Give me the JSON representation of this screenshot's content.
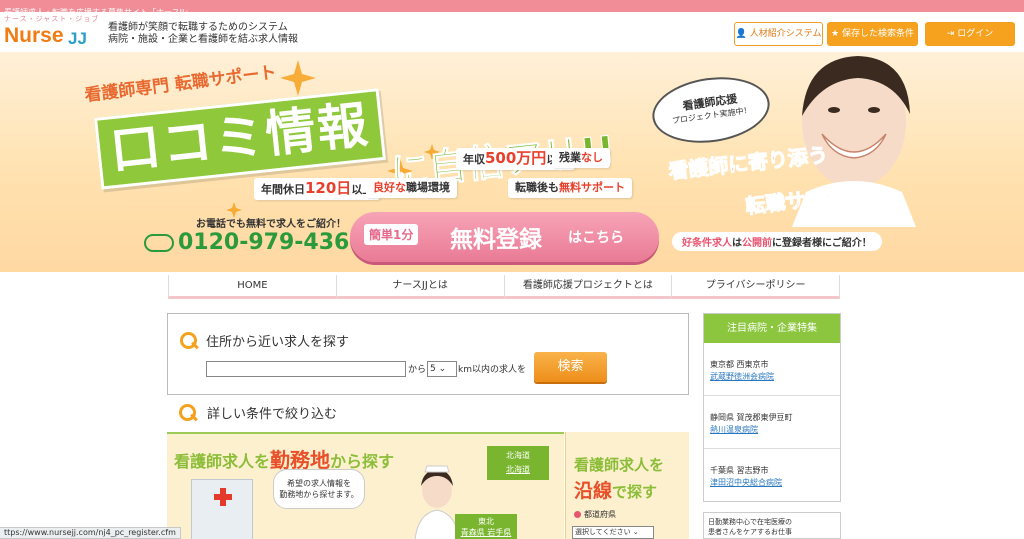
{
  "top_strip": "看護師求人・転職を応援する募集サイト「ナースJJ」",
  "logo": {
    "kana": "ナース・ジャスト・ジョブ",
    "nurse": "Nurse",
    "jj": "JJ"
  },
  "tagline": [
    "看護師が笑顔で転職するためのシステム",
    "病院・施設・企業と看護師を結ぶ求人情報"
  ],
  "header_buttons": {
    "agent": "人材紹介システム",
    "saved": "保存した検索条件",
    "login": "ログイン"
  },
  "hero": {
    "sub": "看護師専門 転職サポート",
    "main": "口コミ情報",
    "main2": "に自信アリ!!",
    "chip_salary": {
      "pre": "年収",
      "num": "500万円",
      "post": "以上"
    },
    "chip_overtime": {
      "pre": "残業",
      "post": "なし"
    },
    "chip_holidays": {
      "pre": "年間休日",
      "num": "120日",
      "post": "以上"
    },
    "chip_env": {
      "em": "良好な",
      "post": "職場環境"
    },
    "chip_support": {
      "pre": "転職後も",
      "em": "無料サポート"
    },
    "phone_note": "お電話でも無料で求人をご紹介！",
    "phone": "0120-979-436",
    "register": {
      "pill": "簡単1分",
      "big": "無料登録",
      "small": "はこちら"
    },
    "badge": {
      "l1": "看護師応援",
      "l2": "プロジェクト実施中！"
    },
    "right1": "看護師に寄り添う",
    "right2": "転職サポート",
    "notice": {
      "a": "好条件求人",
      "b": "は",
      "c": "公開前",
      "d": "に登録者様にご紹介！"
    }
  },
  "nav": [
    "HOME",
    "ナースJJとは",
    "看護師応援プロジェクトとは",
    "プライバシーポリシー"
  ],
  "search": {
    "title": "住所から近い求人を探す",
    "address_placeholder": "",
    "kara": "から",
    "km_value": "5 ⌄",
    "km_text": "km以内の求人を",
    "button": "検索"
  },
  "detail_title": "詳しい条件で絞り込む",
  "map_banner": {
    "title_pre": "看護師求人を",
    "title_em": "勤務地",
    "title_post": "から探す",
    "speech": [
      "希望の求人情報を",
      "勤務地から探せます。"
    ],
    "hokkaido_head": "北海道",
    "hokkaido_link": "北海道",
    "tohoku_head": "東北",
    "tohoku_links": "青森県 岩手県"
  },
  "rail_banner": {
    "line1": "看護師求人を",
    "line2_em": "沿線",
    "line2_post": "で探す",
    "pref_label": "都道府県",
    "pref_select": "選択してください ⌄"
  },
  "sidebar": {
    "title": "注目病院・企業特集",
    "items": [
      {
        "loc": "東京都 西東京市",
        "hosp": "武蔵野徳洲会病院"
      },
      {
        "loc": "静岡県 賀茂郡東伊豆町",
        "hosp": "熱川温泉病院"
      },
      {
        "loc": "千葉県 習志野市",
        "hosp": "津田沼中央総合病院"
      }
    ]
  },
  "side_ad": [
    "日勤業務中心で在宅医療の",
    "患者さんをケアするお仕事"
  ],
  "status_url": "ttps://www.nursejj.com/nj4_pc_register.cfm",
  "colors": {
    "accent": "#f6a21e",
    "green": "#8cc63e",
    "pink": "#e97a95",
    "strip": "#f08d96"
  }
}
